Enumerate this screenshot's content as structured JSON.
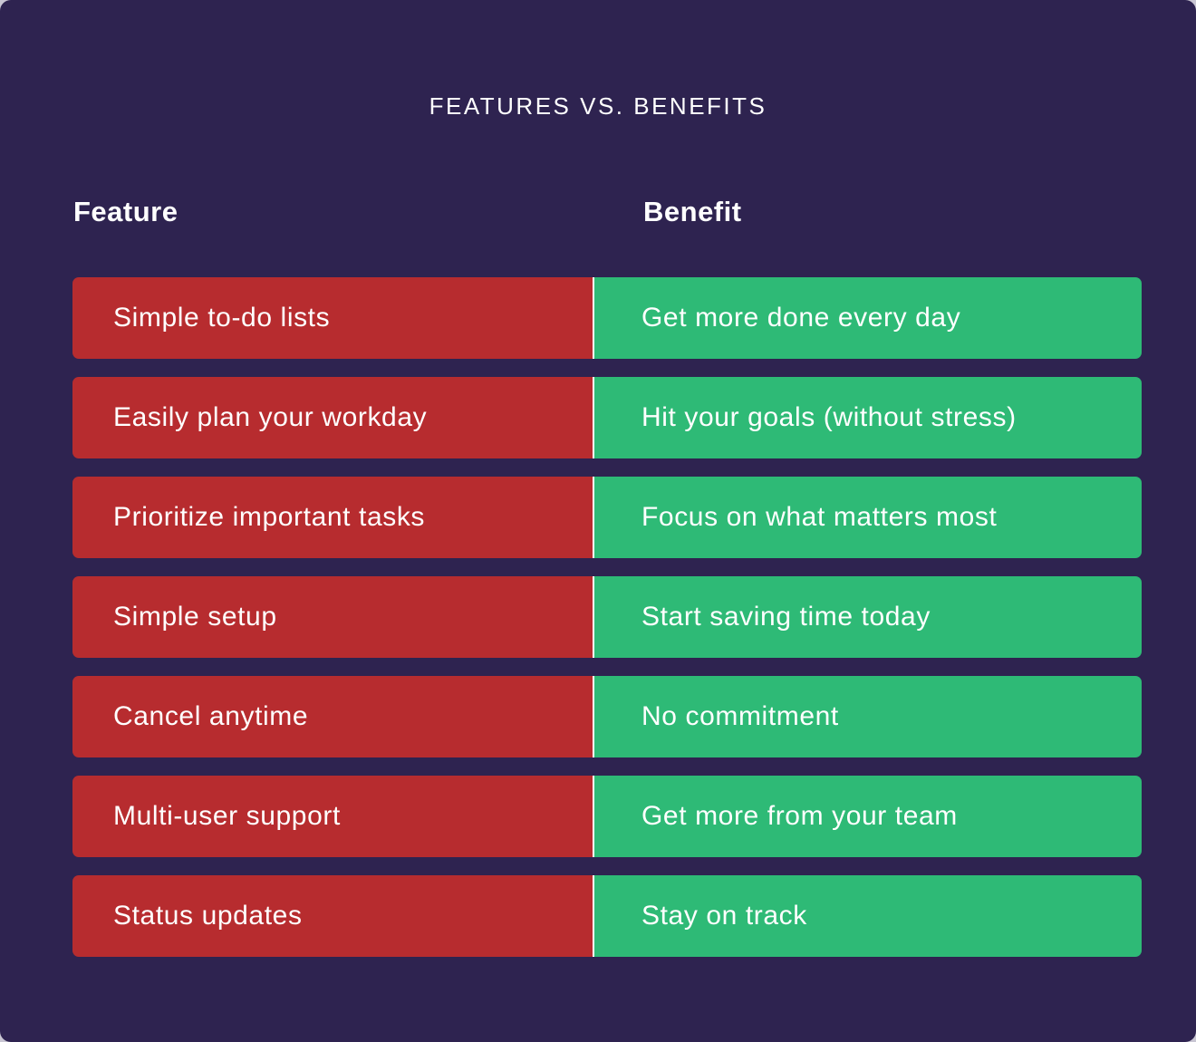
{
  "title": "FEATURES VS. BENEFITS",
  "columns": {
    "feature": "Feature",
    "benefit": "Benefit"
  },
  "colors": {
    "background": "#2e2350",
    "feature": "#b72c2f",
    "benefit": "#2eba76",
    "text": "#ffffff"
  },
  "rows": [
    {
      "feature": "Simple to-do lists",
      "benefit": "Get more done every day"
    },
    {
      "feature": "Easily plan your workday",
      "benefit": "Hit your goals (without stress)"
    },
    {
      "feature": "Prioritize important tasks",
      "benefit": "Focus on what matters most"
    },
    {
      "feature": "Simple setup",
      "benefit": "Start saving time today"
    },
    {
      "feature": "Cancel anytime",
      "benefit": "No commitment"
    },
    {
      "feature": "Multi-user support",
      "benefit": "Get more from your team"
    },
    {
      "feature": "Status updates",
      "benefit": "Stay on track"
    }
  ]
}
